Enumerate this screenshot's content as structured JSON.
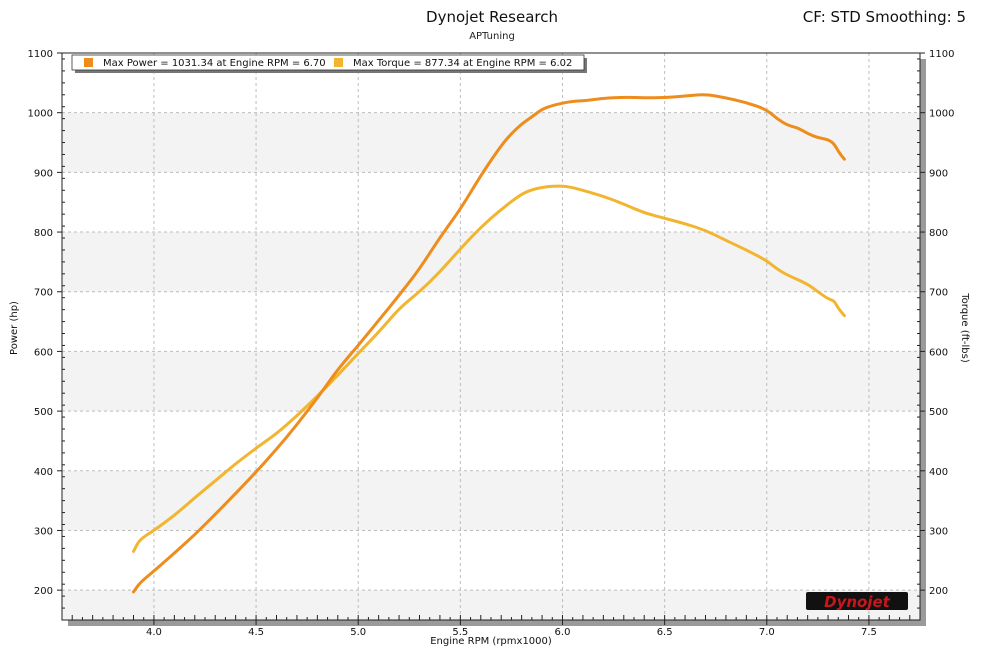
{
  "header": {
    "title": "Dynojet Research",
    "subtitle": "APTuning",
    "correction": "CF: STD Smoothing: 5"
  },
  "logo": {
    "text": "Dynojet"
  },
  "colors": {
    "power": "#ee8c1c",
    "torque": "#f2b530",
    "plot_band": "#f3f3f3",
    "grid": "#bdbdbd"
  },
  "chart_data": {
    "type": "line",
    "xlabel": "Engine RPM (rpmx1000)",
    "ylabel_left": "Power (hp)",
    "ylabel_right": "Torque (ft-lbs)",
    "xlim": [
      3.55,
      7.75
    ],
    "ylim": [
      150,
      1100
    ],
    "x_ticks": [
      "4.0",
      "4.5",
      "5.0",
      "5.5",
      "6.0",
      "6.5",
      "7.0",
      "7.5"
    ],
    "y_ticks_left": [
      "200",
      "300",
      "400",
      "500",
      "600",
      "700",
      "800",
      "900",
      "1000",
      "1100"
    ],
    "y_ticks_right": [
      "200",
      "300",
      "400",
      "500",
      "600",
      "700",
      "800",
      "900",
      "1000",
      "1100"
    ],
    "grid": true,
    "legend_position": "top-left",
    "series": [
      {
        "name": "Max Power = 1031.34 at Engine RPM = 6.70",
        "axis": "left",
        "x": [
          3.9,
          3.93,
          4.0,
          4.1,
          4.2,
          4.3,
          4.4,
          4.5,
          4.6,
          4.7,
          4.8,
          4.9,
          5.0,
          5.1,
          5.2,
          5.3,
          5.4,
          5.5,
          5.6,
          5.7,
          5.75,
          5.8,
          5.85,
          5.9,
          5.95,
          6.0,
          6.05,
          6.1,
          6.15,
          6.2,
          6.3,
          6.4,
          6.5,
          6.6,
          6.7,
          6.8,
          6.9,
          7.0,
          7.05,
          7.1,
          7.15,
          7.2,
          7.25,
          7.3,
          7.33,
          7.35,
          7.38
        ],
        "y": [
          197,
          212,
          232,
          262,
          293,
          327,
          362,
          398,
          436,
          477,
          522,
          570,
          610,
          652,
          694,
          738,
          791,
          838,
          895,
          945,
          965,
          981,
          993,
          1006,
          1012,
          1016,
          1019,
          1020,
          1022,
          1024,
          1026,
          1025,
          1025,
          1028,
          1031,
          1025,
          1017,
          1005,
          990,
          979,
          975,
          965,
          958,
          955,
          948,
          935,
          922
        ]
      },
      {
        "name": "Max Torque = 877.34 at Engine RPM = 6.02",
        "axis": "right",
        "x": [
          3.9,
          3.93,
          4.0,
          4.1,
          4.2,
          4.3,
          4.4,
          4.5,
          4.6,
          4.7,
          4.8,
          4.9,
          5.0,
          5.1,
          5.2,
          5.3,
          5.4,
          5.5,
          5.6,
          5.7,
          5.8,
          5.85,
          5.9,
          5.95,
          6.02,
          6.1,
          6.2,
          6.3,
          6.4,
          6.5,
          6.6,
          6.7,
          6.8,
          6.9,
          7.0,
          7.05,
          7.1,
          7.2,
          7.25,
          7.3,
          7.33,
          7.35,
          7.38
        ],
        "y": [
          265,
          285,
          300,
          325,
          355,
          383,
          412,
          438,
          462,
          492,
          525,
          560,
          597,
          632,
          672,
          700,
          733,
          772,
          808,
          838,
          864,
          871,
          875,
          877,
          877,
          870,
          860,
          847,
          832,
          823,
          814,
          803,
          786,
          770,
          752,
          738,
          728,
          713,
          700,
          688,
          685,
          672,
          660
        ]
      }
    ]
  }
}
